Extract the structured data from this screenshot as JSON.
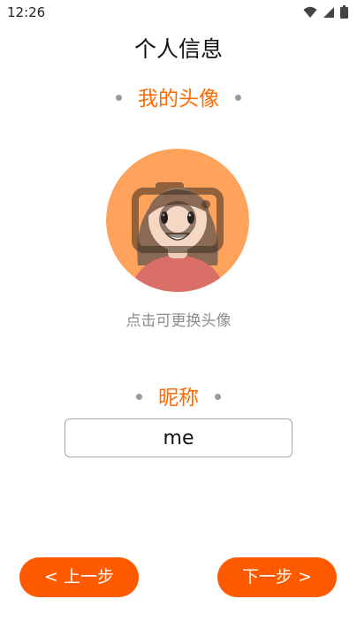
{
  "status_bar": {
    "time": "12:26",
    "icons": [
      "wifi-icon",
      "signal-icon",
      "battery-icon"
    ]
  },
  "page": {
    "title": "个人信息"
  },
  "avatar_section": {
    "heading": "我的头像",
    "hint": "点击可更换头像"
  },
  "nickname_section": {
    "heading": "昵称",
    "value": "me"
  },
  "navigation": {
    "prev_label": "< 上一步",
    "next_label": "下一步 >"
  },
  "colors": {
    "accent": "#ff6a00",
    "button": "#ff5a00",
    "avatar_bg": "#ffa35c",
    "hint": "#8c8c8c"
  }
}
